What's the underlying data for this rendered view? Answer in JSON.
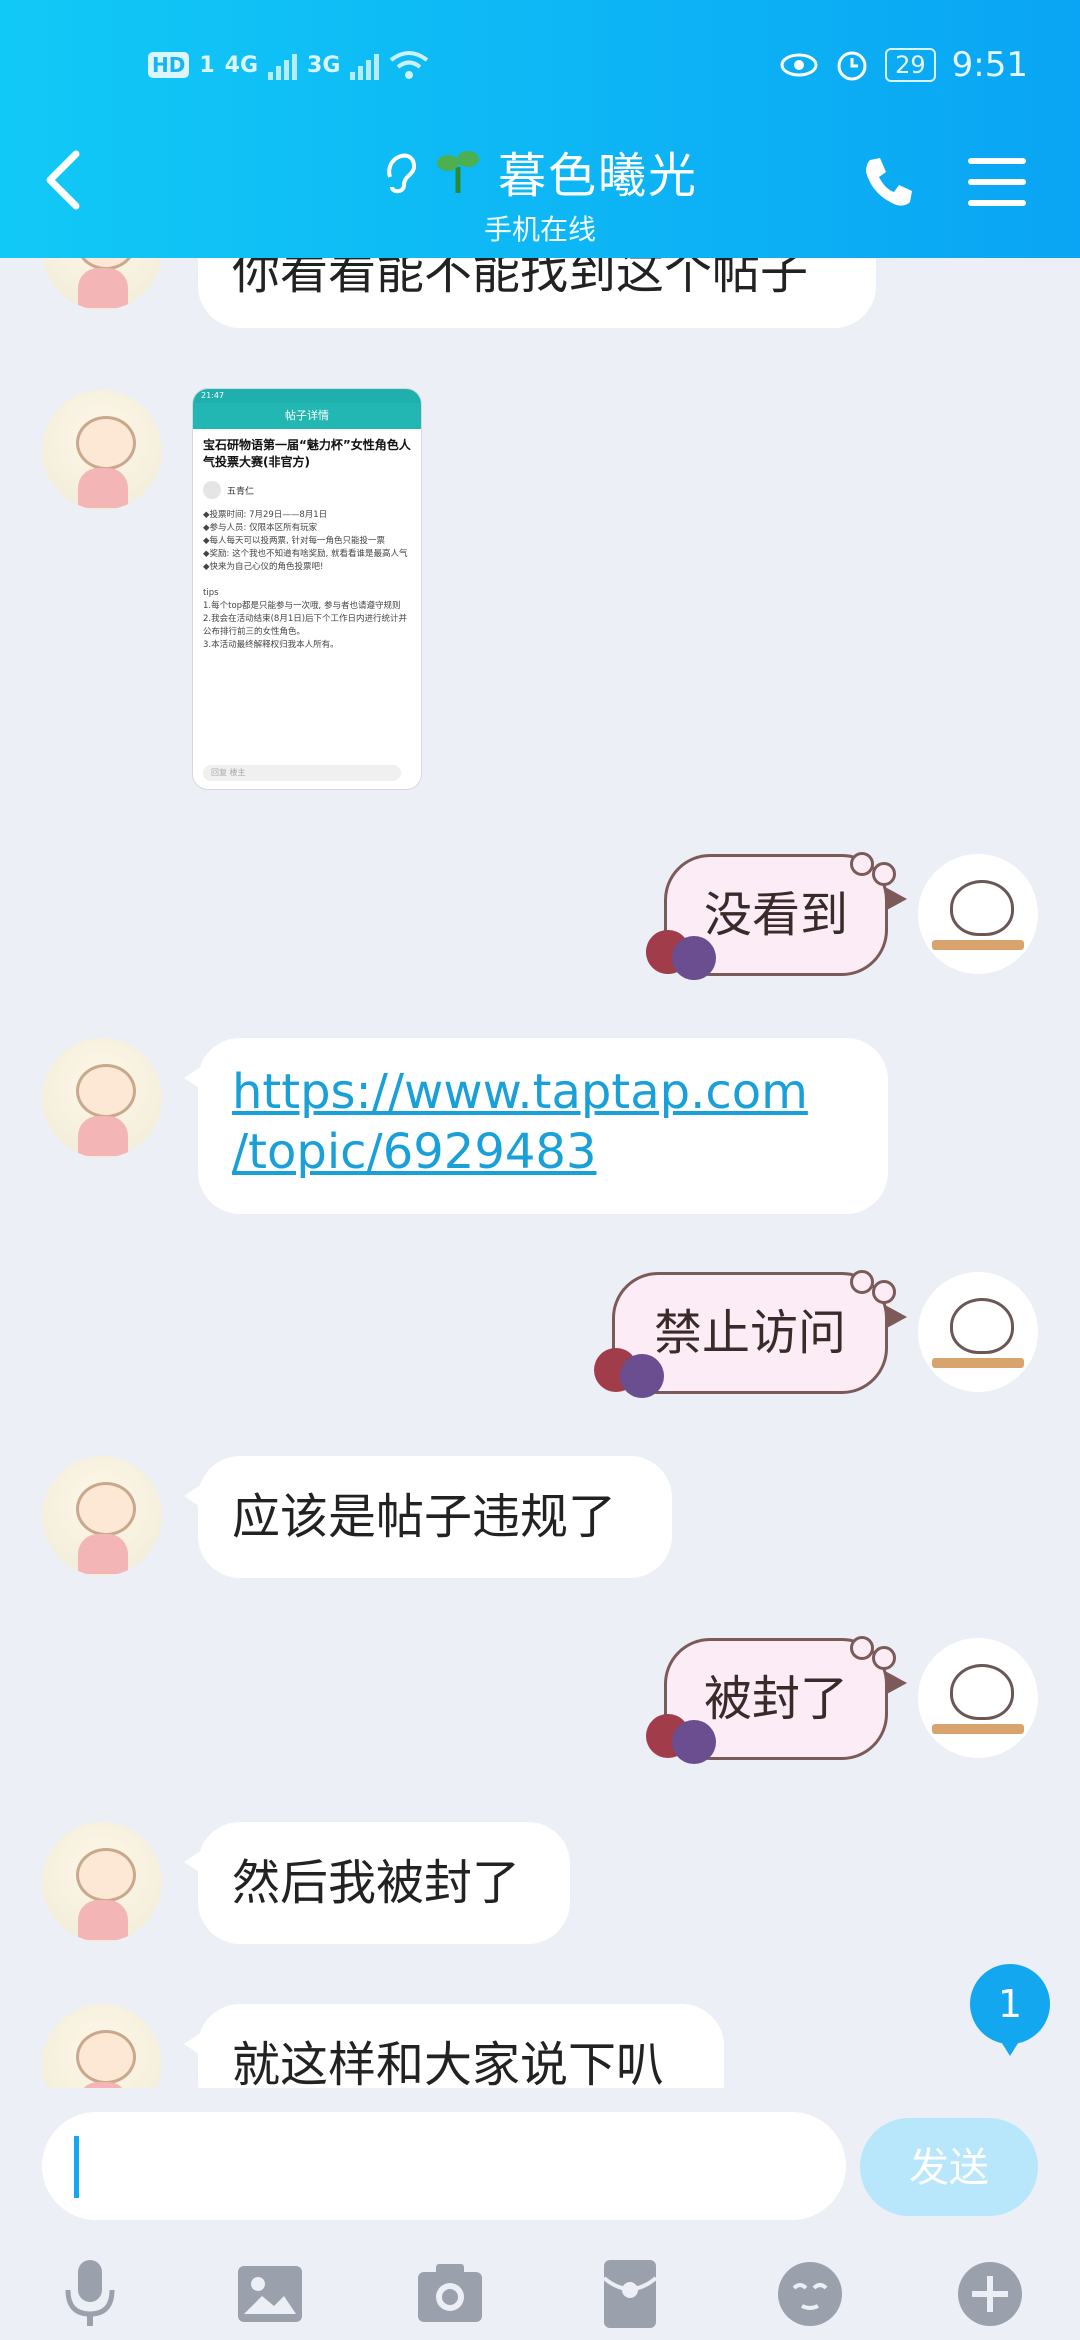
{
  "status_bar": {
    "hd": "HD",
    "sim1": "1",
    "net1": "4G",
    "net2": "3G",
    "battery": "29",
    "time": "9:51"
  },
  "header": {
    "title": "暮色曦光",
    "subtitle": "手机在线",
    "icons": [
      "back-icon",
      "ear-icon",
      "sprout-icon",
      "phone-icon",
      "menu-icon"
    ]
  },
  "messages": [
    {
      "side": "left",
      "type": "text",
      "text": "你看看能不能找到这个帖子"
    },
    {
      "side": "left",
      "type": "image",
      "image": {
        "status_time": "21:47",
        "nav_title": "帖子详情",
        "post_title": "宝石研物语第一届“魅力杯”女性角色人气投票大赛(非官方)",
        "author": "五青仁",
        "body": "◆投票时间: 7月29日——8月1日\n◆参与人员: 仅限本区所有玩家\n◆每人每天可以投两票, 针对每一角色只能投一票\n◆奖励: 这个我也不知道有啥奖励, 就看看谁是最高人气\n◆快来为自己心仪的角色投票吧!\n\ntips\n1.每个top都是只能参与一次哦, 参与者也请遵守规则\n2.我会在活动结束(8月1日)后下个工作日内进行统计并公布排行前三的女性角色。\n3.本活动最终解释权归我本人所有。",
        "input_placeholder": "回复 楼主"
      }
    },
    {
      "side": "right",
      "type": "text",
      "text": "没看到"
    },
    {
      "side": "left",
      "type": "link",
      "text_line1": "https://www.taptap.com",
      "text_line2": "/topic/6929483"
    },
    {
      "side": "right",
      "type": "text",
      "text": "禁止访问"
    },
    {
      "side": "left",
      "type": "text",
      "text": "应该是帖子违规了"
    },
    {
      "side": "right",
      "type": "text",
      "text": "被封了"
    },
    {
      "side": "left",
      "type": "text",
      "text": "然后我被封了"
    },
    {
      "side": "left",
      "type": "text",
      "text": "就这样和大家说下叭"
    }
  ],
  "unread_count": "1",
  "input": {
    "value": "",
    "send_label": "发送"
  },
  "toolbar": [
    "microphone-icon",
    "image-icon",
    "camera-icon",
    "red-packet-icon",
    "emoji-icon",
    "plus-icon"
  ],
  "colors": {
    "header_start": "#11c9f6",
    "header_end": "#0aa5f4",
    "background": "#eceff5",
    "link": "#1aa0d8",
    "send_disabled": "#b8e7fb"
  }
}
